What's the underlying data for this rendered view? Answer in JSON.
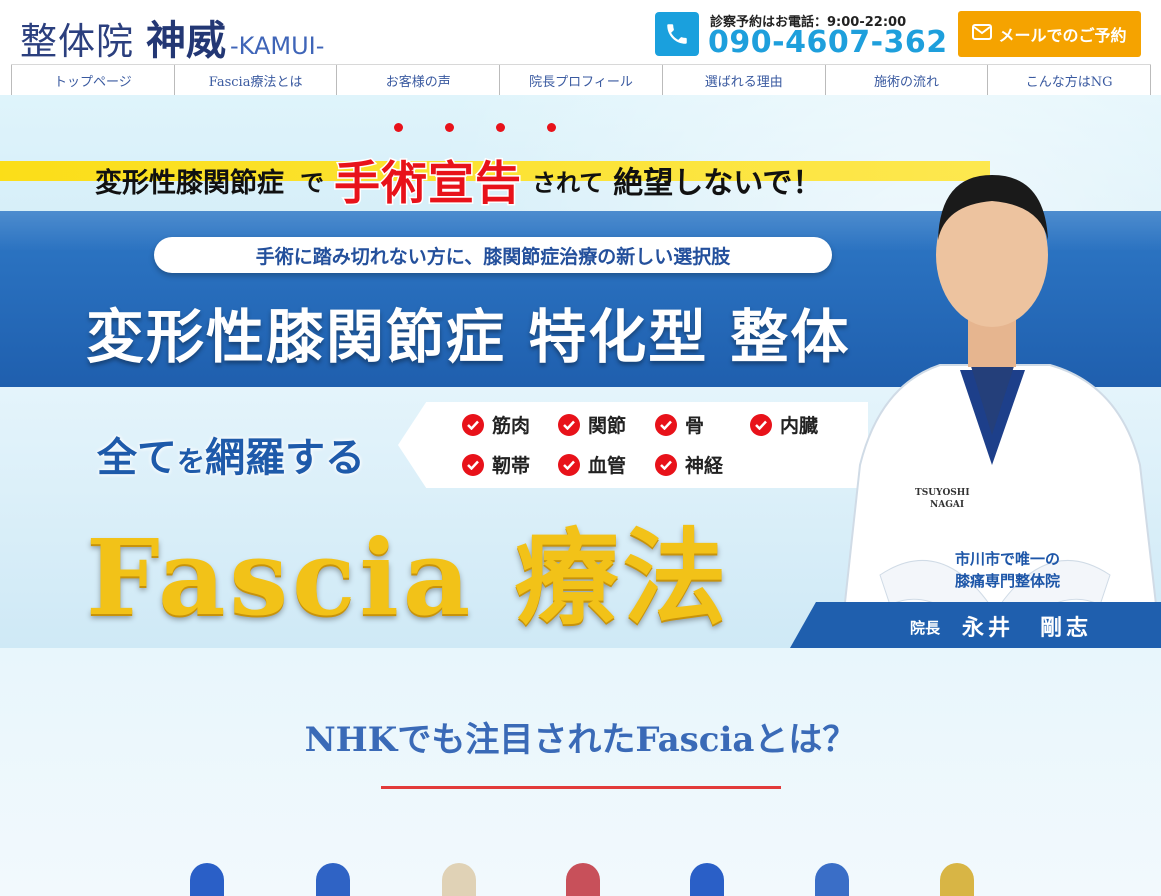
{
  "header": {
    "logo": {
      "kanji": "整体院",
      "name": "神威",
      "latin": "-KAMUI-"
    },
    "phone": {
      "icon": "phone-icon",
      "hours": "診察予約はお電話：9:00-22:00",
      "number": "090-4607-362"
    },
    "mail_button": {
      "icon": "envelope-icon",
      "label": "メールでのご予約"
    }
  },
  "nav": {
    "items": [
      {
        "label": "トップページ"
      },
      {
        "label": "Fascia療法とは"
      },
      {
        "label": "お客様の声"
      },
      {
        "label": "院長プロフィール"
      },
      {
        "label": "選ばれる理由"
      },
      {
        "label": "施術の流れ"
      },
      {
        "label": "こんな方はNG"
      }
    ]
  },
  "hero": {
    "headline": {
      "part1": "変形性膝関節症",
      "part2": "で",
      "emphasis": "手術宣告",
      "part3": "されて",
      "part4": "絶望しないで！"
    },
    "pill": "手術に踏み切れない方に、膝関節症治療の新しい選択肢",
    "title": "変形性膝関節症 特化型 整体",
    "subtitle": {
      "a": "全て",
      "b": "を",
      "c": "網羅する"
    },
    "checks": [
      "筋肉",
      "関節",
      "骨",
      "内臓",
      "靭帯",
      "血管",
      "神経"
    ],
    "fascia": "Fascia 療法",
    "doctor": {
      "coat_name": "TSUYOSHI NAGAI",
      "tagline_1": "市川市で唯一の",
      "tagline_2": "膝痛専門整体院",
      "role": "院長",
      "name": "永井　剛志"
    }
  },
  "section": {
    "title": "NHKでも注目されたFasciaとは？"
  },
  "colors": {
    "brand_navy": "#233774",
    "phone_blue": "#1e9fdc",
    "mail_orange": "#f5a300",
    "hero_band": "#1f5fae",
    "accent_red": "#e8121a",
    "fascia_gold": "#f2c218"
  }
}
